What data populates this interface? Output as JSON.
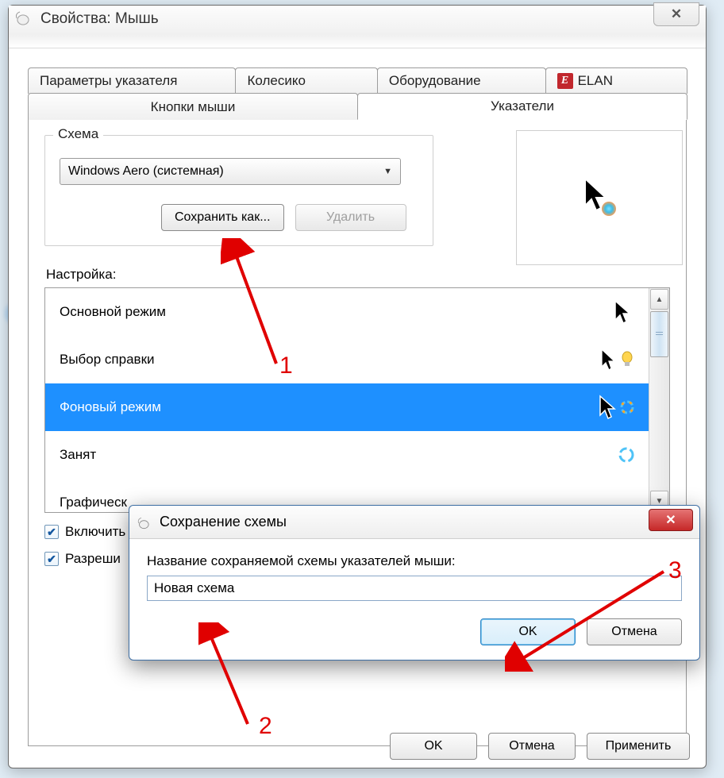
{
  "main_window": {
    "title": "Свойства: Мышь",
    "close_symbol": "✕",
    "tabs_row1": [
      {
        "label": "Параметры указателя"
      },
      {
        "label": "Колесико"
      },
      {
        "label": "Оборудование"
      },
      {
        "label": "ELAN",
        "hasLogo": true
      }
    ],
    "tabs_row2": [
      {
        "label": "Кнопки мыши"
      },
      {
        "label": "Указатели",
        "active": true
      }
    ],
    "scheme_group_label": "Схема",
    "scheme_selected": "Windows Aero (системная)",
    "save_as_label": "Сохранить как...",
    "delete_label": "Удалить",
    "settings_label": "Настройка:",
    "cursor_items": [
      {
        "label": "Основной режим",
        "selected": false
      },
      {
        "label": "Выбор справки",
        "selected": false
      },
      {
        "label": "Фоновый режим",
        "selected": true
      },
      {
        "label": "Занят",
        "selected": false
      },
      {
        "label": "Графическ",
        "selected": false
      }
    ],
    "checkbox1_label": "Включить",
    "checkbox2_label": "Разреши",
    "bottom_buttons": {
      "ok": "OK",
      "cancel": "Отмена",
      "apply": "Применить"
    }
  },
  "save_dialog": {
    "title": "Сохранение схемы",
    "prompt": "Название сохраняемой схемы указателей мыши:",
    "input_value": "Новая схема",
    "ok": "OK",
    "cancel": "Отмена",
    "close_symbol": "✕"
  },
  "annotations": {
    "a1": "1",
    "a2": "2",
    "a3": "3"
  }
}
